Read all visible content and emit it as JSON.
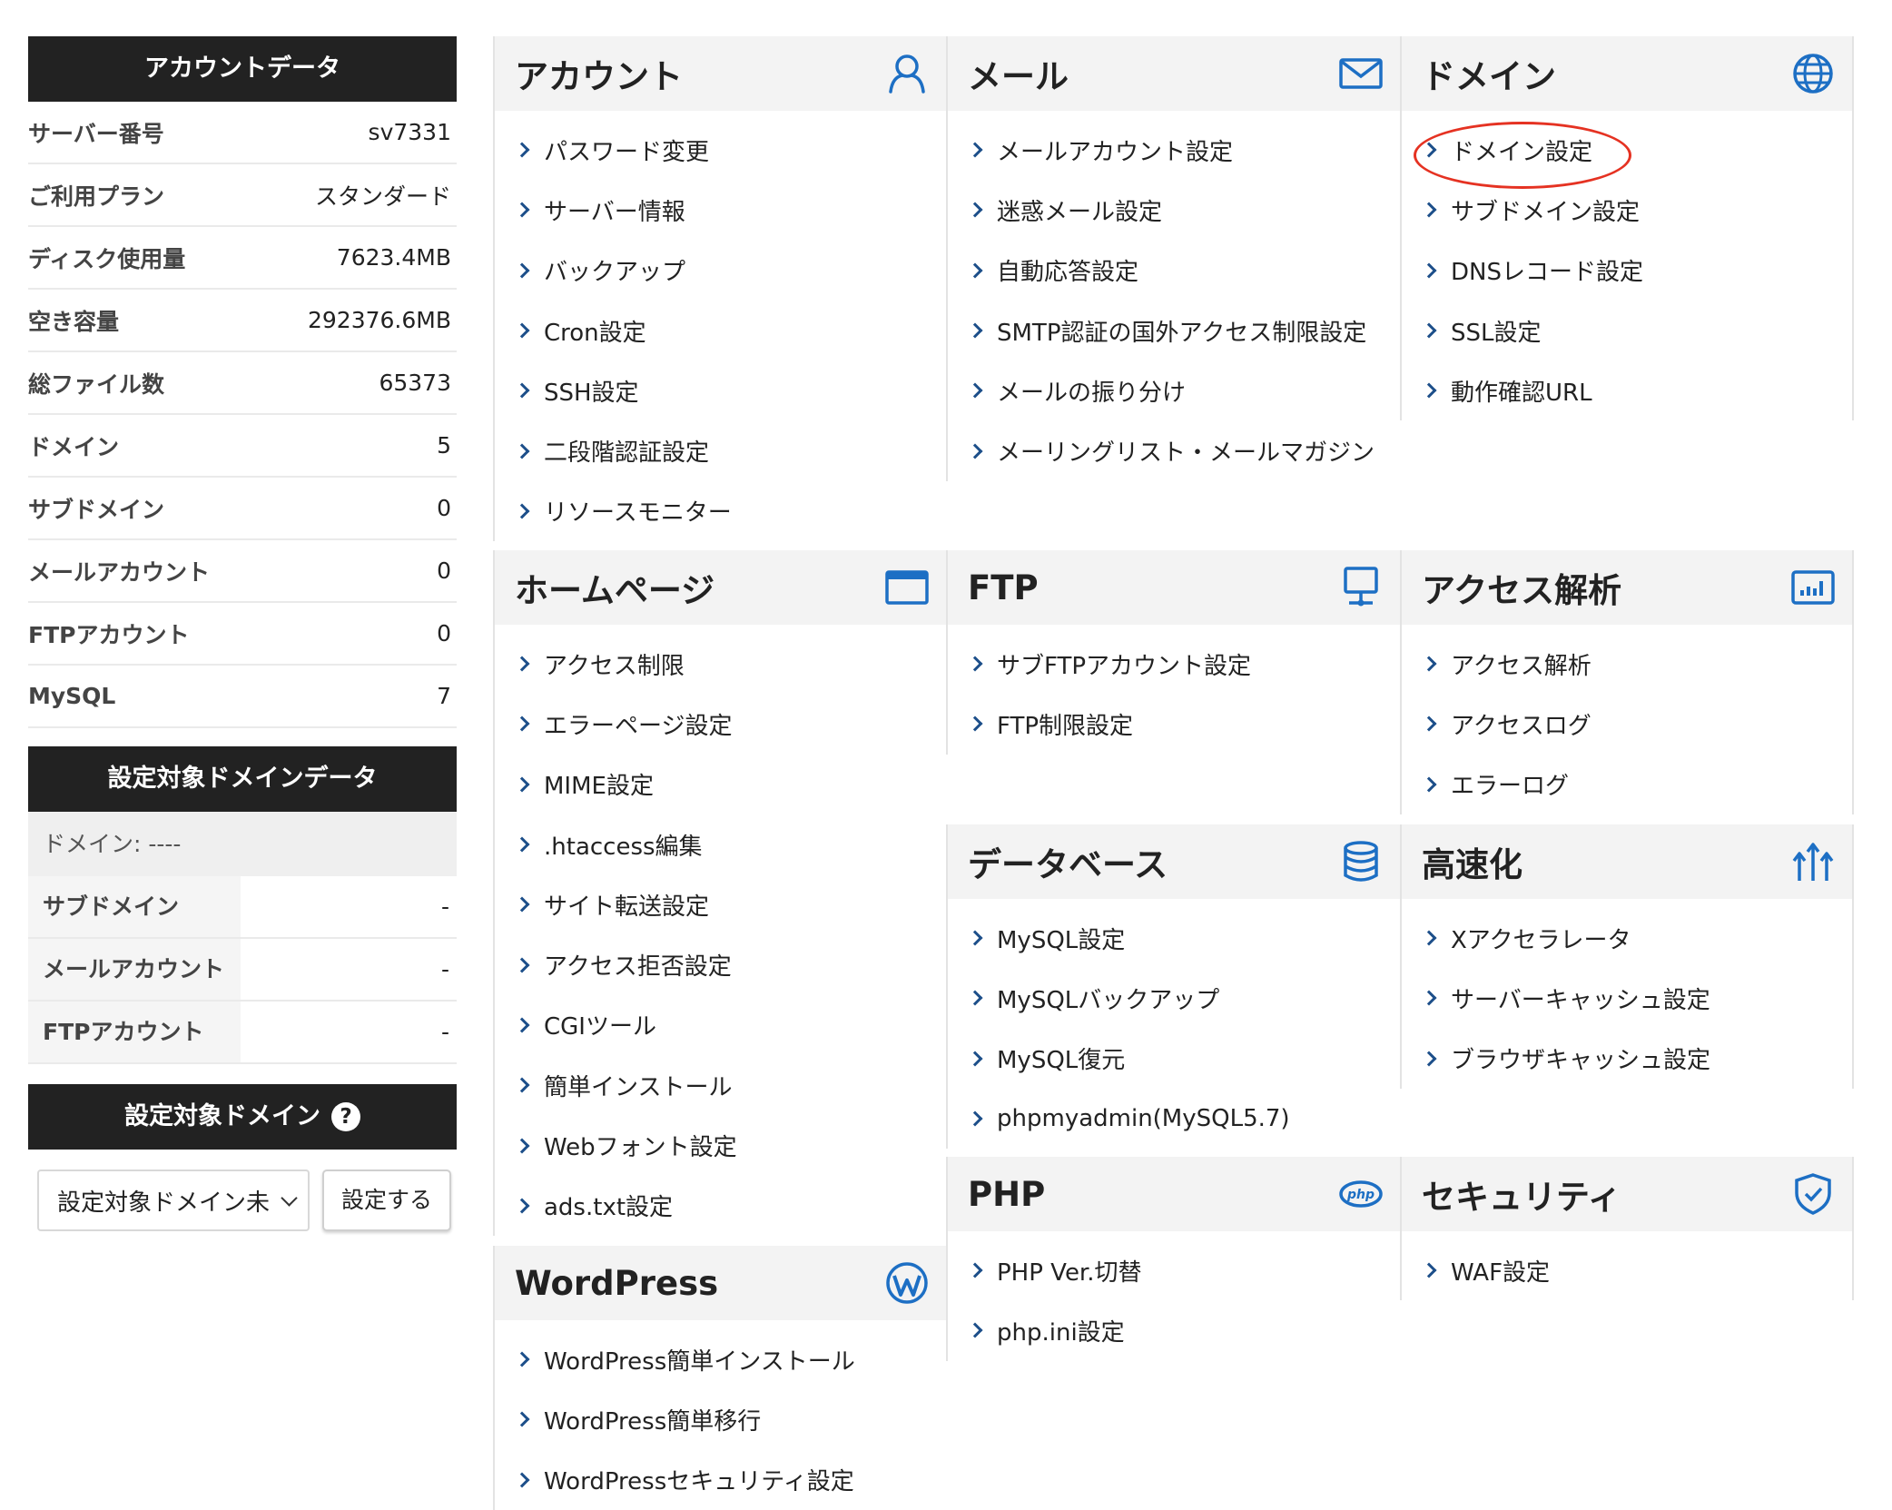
{
  "account": {
    "heading": "アカウントデータ",
    "rows": [
      {
        "label": "サーバー番号",
        "value": "sv7331"
      },
      {
        "label": "ご利用プラン",
        "value": "スタンダード"
      },
      {
        "label": "ディスク使用量",
        "value": "7623.4MB"
      },
      {
        "label": "空き容量",
        "value": "292376.6MB"
      },
      {
        "label": "総ファイル数",
        "value": "65373"
      },
      {
        "label": "ドメイン",
        "value": "5"
      },
      {
        "label": "サブドメイン",
        "value": "0"
      },
      {
        "label": "メールアカウント",
        "value": "0"
      },
      {
        "label": "FTPアカウント",
        "value": "0"
      },
      {
        "label": "MySQL",
        "value": "7"
      }
    ]
  },
  "target_domain_data": {
    "heading": "設定対象ドメインデータ",
    "domain_line": "ドメイン: ----",
    "rows": [
      {
        "label": "サブドメイン",
        "value": "-"
      },
      {
        "label": "メールアカウント",
        "value": "-"
      },
      {
        "label": "FTPアカウント",
        "value": "-"
      }
    ]
  },
  "target_domain": {
    "heading": "設定対象ドメイン",
    "help_icon": "?",
    "select_value": "設定対象ドメイン未",
    "button_label": "設定する"
  },
  "panels": {
    "account": {
      "title": "アカウント",
      "icon": "user-icon",
      "items": [
        "パスワード変更",
        "サーバー情報",
        "バックアップ",
        "Cron設定",
        "SSH設定",
        "二段階認証設定",
        "リソースモニター"
      ]
    },
    "mail": {
      "title": "メール",
      "icon": "mail-icon",
      "items": [
        "メールアカウント設定",
        "迷惑メール設定",
        "自動応答設定",
        "SMTP認証の国外アクセス制限設定",
        "メールの振り分け",
        "メーリングリスト・メールマガジン"
      ]
    },
    "domain": {
      "title": "ドメイン",
      "icon": "globe-icon",
      "items": [
        "ドメイン設定",
        "サブドメイン設定",
        "DNSレコード設定",
        "SSL設定",
        "動作確認URL"
      ]
    },
    "homepage": {
      "title": "ホームページ",
      "icon": "browser-window-icon",
      "items": [
        "アクセス制限",
        "エラーページ設定",
        "MIME設定",
        ".htaccess編集",
        "サイト転送設定",
        "アクセス拒否設定",
        "CGIツール",
        "簡単インストール",
        "Webフォント設定",
        "ads.txt設定"
      ]
    },
    "ftp": {
      "title": "FTP",
      "icon": "monitor-network-icon",
      "items": [
        "サブFTPアカウント設定",
        "FTP制限設定"
      ]
    },
    "access": {
      "title": "アクセス解析",
      "icon": "bar-chart-icon",
      "items": [
        "アクセス解析",
        "アクセスログ",
        "エラーログ"
      ]
    },
    "database": {
      "title": "データベース",
      "icon": "database-icon",
      "items": [
        "MySQL設定",
        "MySQLバックアップ",
        "MySQL復元",
        "phpmyadmin(MySQL5.7)"
      ]
    },
    "speed": {
      "title": "高速化",
      "icon": "speed-arrows-icon",
      "items": [
        "Xアクセラレータ",
        "サーバーキャッシュ設定",
        "ブラウザキャッシュ設定"
      ]
    },
    "wordpress": {
      "title": "WordPress",
      "icon": "wordpress-icon",
      "items": [
        "WordPress簡単インストール",
        "WordPress簡単移行",
        "WordPressセキュリティ設定"
      ]
    },
    "php": {
      "title": "PHP",
      "icon": "php-icon",
      "items": [
        "PHP Ver.切替",
        "php.ini設定"
      ]
    },
    "security": {
      "title": "セキュリティ",
      "icon": "shield-icon",
      "items": [
        "WAF設定"
      ]
    }
  },
  "colors": {
    "accent_blue": "#1d6fc4",
    "arrow_navy": "#1d4f8a",
    "highlight_red": "#e53222",
    "header_dark": "#222222"
  }
}
